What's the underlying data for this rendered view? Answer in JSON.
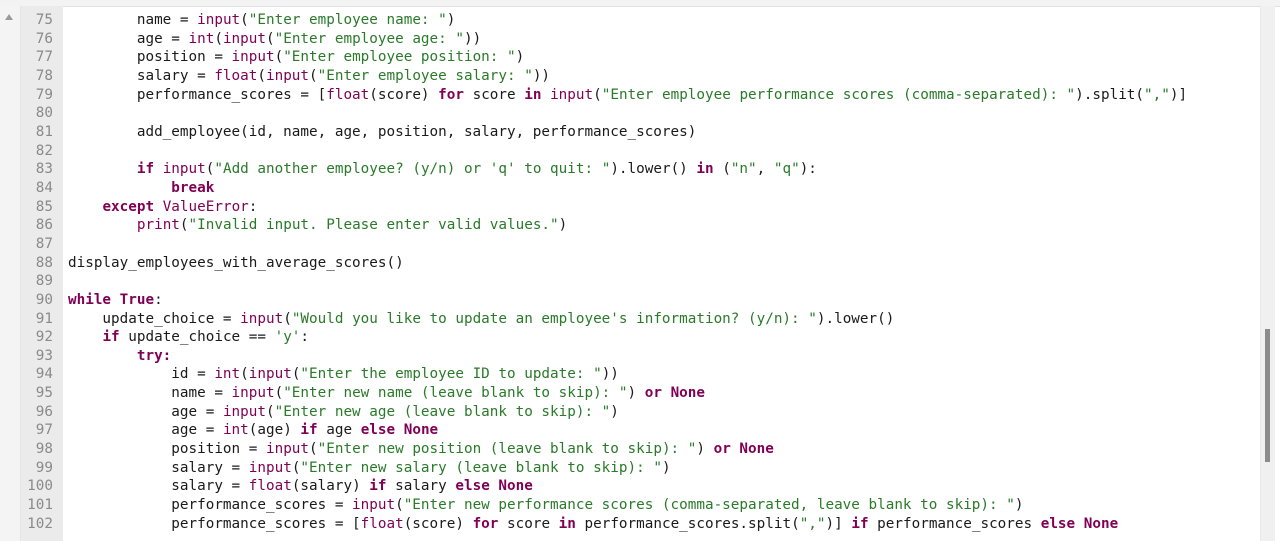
{
  "editor": {
    "language": "python",
    "colors": {
      "keyword": "#7f0055",
      "builtin": "#7f0055",
      "string": "#2a7a2a",
      "text": "#1a1a1a",
      "line_number": "#8a8a8a"
    },
    "scroll_position_fraction": 0.6,
    "lines": [
      {
        "n": "75",
        "code": "        name = input(\"Enter employee name: \")"
      },
      {
        "n": "76",
        "code": "        age = int(input(\"Enter employee age: \"))"
      },
      {
        "n": "77",
        "code": "        position = input(\"Enter employee position: \")"
      },
      {
        "n": "78",
        "code": "        salary = float(input(\"Enter employee salary: \"))"
      },
      {
        "n": "79",
        "code": "        performance_scores = [float(score) for score in input(\"Enter employee performance scores (comma-separated): \").split(\",\")]"
      },
      {
        "n": "80",
        "code": ""
      },
      {
        "n": "81",
        "code": "        add_employee(id, name, age, position, salary, performance_scores)"
      },
      {
        "n": "82",
        "code": ""
      },
      {
        "n": "83",
        "code": "        if input(\"Add another employee? (y/n) or 'q' to quit: \").lower() in (\"n\", \"q\"):"
      },
      {
        "n": "84",
        "code": "            break"
      },
      {
        "n": "85",
        "code": "    except ValueError:"
      },
      {
        "n": "86",
        "code": "        print(\"Invalid input. Please enter valid values.\")"
      },
      {
        "n": "87",
        "code": ""
      },
      {
        "n": "88",
        "code": "display_employees_with_average_scores()"
      },
      {
        "n": "89",
        "code": ""
      },
      {
        "n": "90",
        "code": "while True:"
      },
      {
        "n": "91",
        "code": "    update_choice = input(\"Would you like to update an employee's information? (y/n): \").lower()"
      },
      {
        "n": "92",
        "code": "    if update_choice == 'y':"
      },
      {
        "n": "93",
        "code": "        try:"
      },
      {
        "n": "94",
        "code": "            id = int(input(\"Enter the employee ID to update: \"))"
      },
      {
        "n": "95",
        "code": "            name = input(\"Enter new name (leave blank to skip): \") or None"
      },
      {
        "n": "96",
        "code": "            age = input(\"Enter new age (leave blank to skip): \")"
      },
      {
        "n": "97",
        "code": "            age = int(age) if age else None"
      },
      {
        "n": "98",
        "code": "            position = input(\"Enter new position (leave blank to skip): \") or None"
      },
      {
        "n": "99",
        "code": "            salary = input(\"Enter new salary (leave blank to skip): \")"
      },
      {
        "n": "100",
        "code": "            salary = float(salary) if salary else None"
      },
      {
        "n": "101",
        "code": "            performance_scores = input(\"Enter new performance scores (comma-separated, leave blank to skip): \")"
      },
      {
        "n": "102",
        "code": "            performance_scores = [float(score) for score in performance_scores.split(\",\")] if performance_scores else None"
      }
    ]
  }
}
